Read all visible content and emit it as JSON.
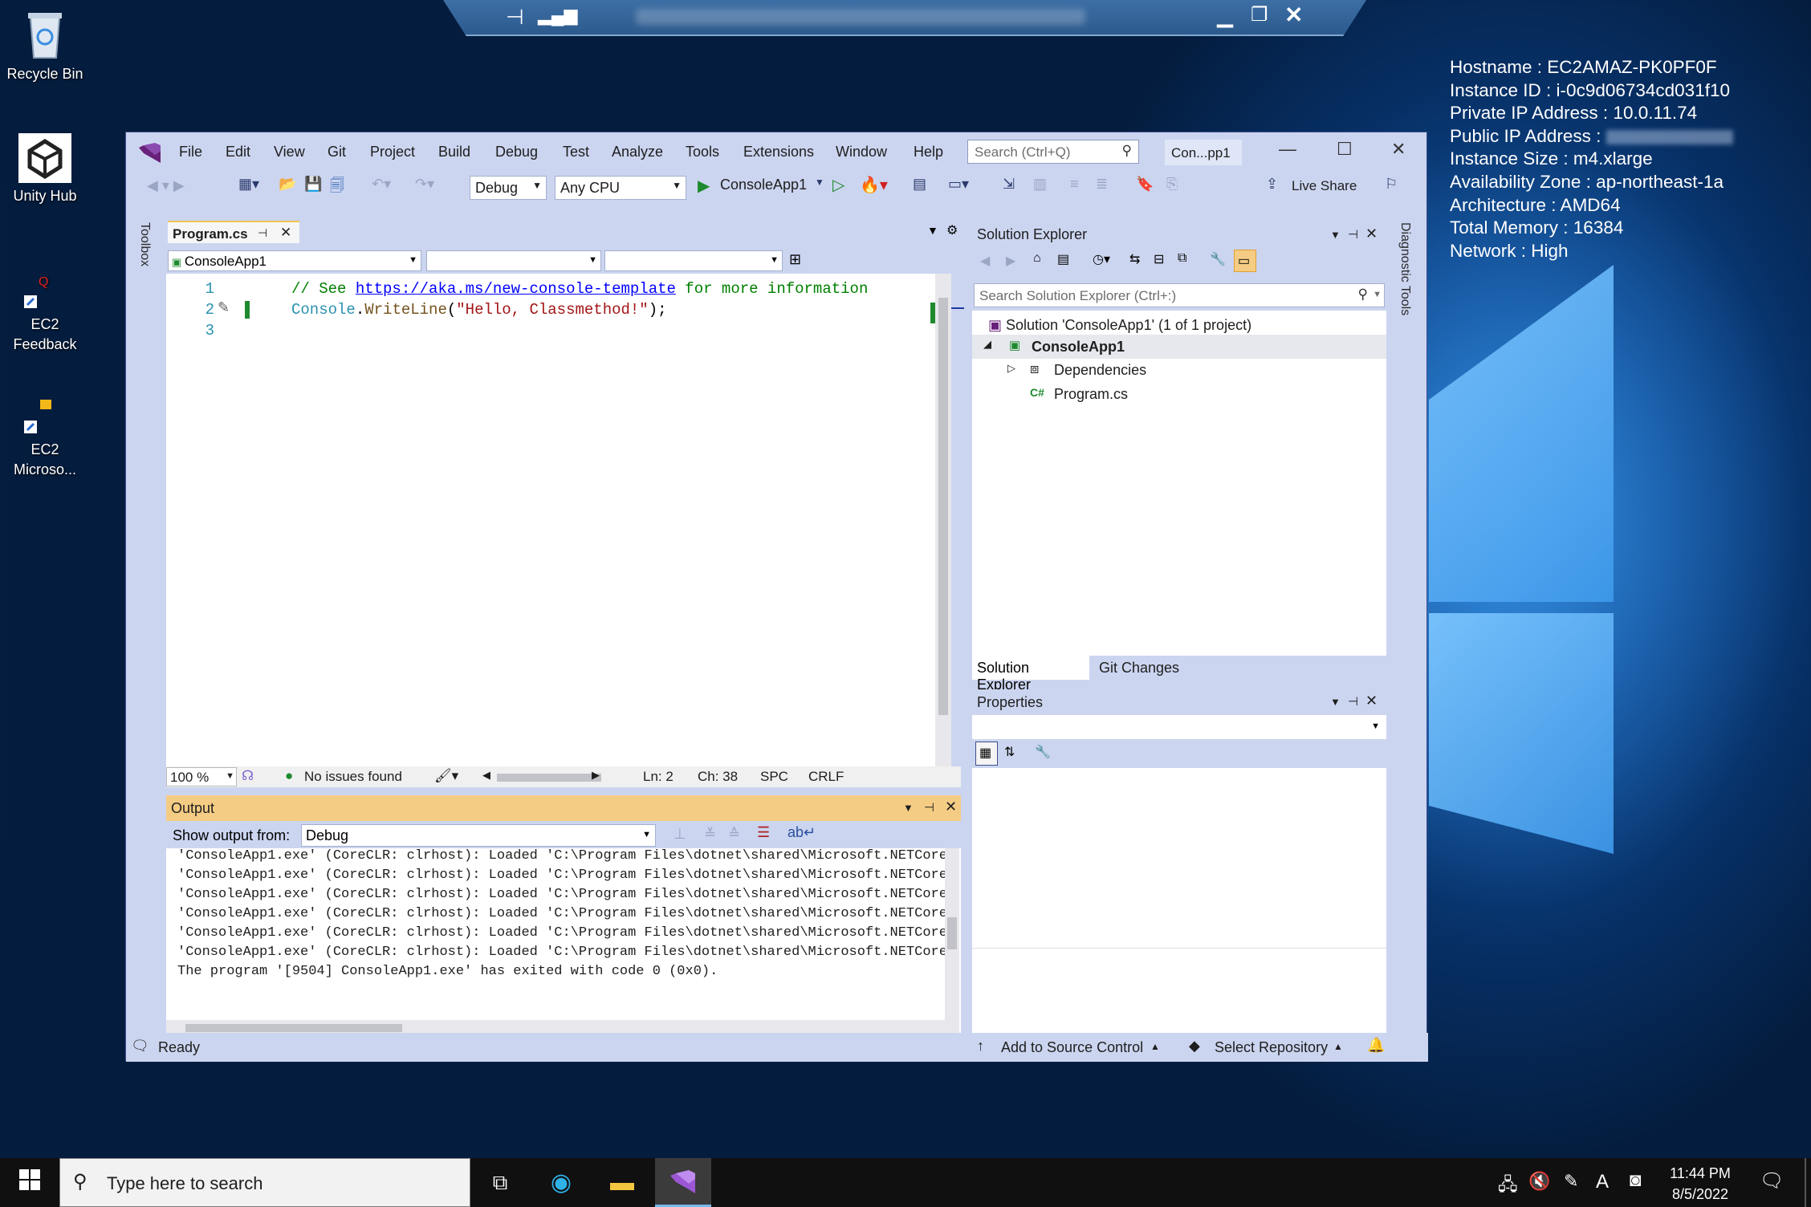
{
  "desktop": {
    "icons": [
      {
        "label": "Recycle Bin"
      },
      {
        "label": "Unity Hub"
      },
      {
        "label": "EC2 Feedback"
      },
      {
        "label": "EC2 Microso..."
      }
    ]
  },
  "info": {
    "hostname": "Hostname : EC2AMAZ-PK0PF0F",
    "instance_id": "Instance ID : i-0c9d06734cd031f10",
    "private_ip": "Private IP Address : 10.0.11.74",
    "public_ip": "Public IP Address :",
    "instance_size": "Instance Size : m4.xlarge",
    "az": "Availability Zone : ap-northeast-1a",
    "arch": "Architecture : AMD64",
    "memory": "Total Memory : 16384",
    "network": "Network : High"
  },
  "vs": {
    "menu": [
      "File",
      "Edit",
      "View",
      "Git",
      "Project",
      "Build",
      "Debug",
      "Test",
      "Analyze",
      "Tools",
      "Extensions",
      "Window",
      "Help"
    ],
    "search_placeholder": "Search (Ctrl+Q)",
    "solution_short": "Con...pp1",
    "config": "Debug",
    "platform": "Any CPU",
    "start_target": "ConsoleApp1",
    "live_share": "Live Share",
    "toolbox": "Toolbox",
    "diagnostic": "Diagnostic Tools",
    "tab": "Program.cs",
    "nav_project": "ConsoleApp1",
    "code": {
      "l1_num": "1",
      "l2_num": "2",
      "l3_num": "3",
      "l1_comment": "// See ",
      "l1_link": "https://aka.ms/new-console-template",
      "l1_tail": " for more information",
      "l2_a": "Console",
      "l2_b": ".",
      "l2_c": "WriteLine",
      "l2_d": "(",
      "l2_e": "\"Hello, Classmethod!\"",
      "l2_f": ");"
    },
    "editor_status": {
      "zoom": "100 %",
      "issues": "No issues found",
      "ln": "Ln: 2",
      "ch": "Ch: 38",
      "spc": "SPC",
      "crlf": "CRLF"
    },
    "output": {
      "title": "Output",
      "show_from": "Show output from:",
      "source": "Debug",
      "lines": [
        "'ConsoleApp1.exe' (CoreCLR: clrhost): Loaded 'C:\\Program Files\\dotnet\\shared\\Microsoft.NETCore.",
        "'ConsoleApp1.exe' (CoreCLR: clrhost): Loaded 'C:\\Program Files\\dotnet\\shared\\Microsoft.NETCore.",
        "'ConsoleApp1.exe' (CoreCLR: clrhost): Loaded 'C:\\Program Files\\dotnet\\shared\\Microsoft.NETCore.",
        "'ConsoleApp1.exe' (CoreCLR: clrhost): Loaded 'C:\\Program Files\\dotnet\\shared\\Microsoft.NETCore.",
        "'ConsoleApp1.exe' (CoreCLR: clrhost): Loaded 'C:\\Program Files\\dotnet\\shared\\Microsoft.NETCore.",
        "'ConsoleApp1.exe' (CoreCLR: clrhost): Loaded 'C:\\Program Files\\dotnet\\shared\\Microsoft.NETCore.",
        "The program '[9504] ConsoleApp1.exe' has exited with code 0 (0x0)."
      ]
    },
    "solution_explorer": {
      "title": "Solution Explorer",
      "search": "Search Solution Explorer (Ctrl+:)",
      "solution": "Solution 'ConsoleApp1' (1 of 1 project)",
      "project": "ConsoleApp1",
      "deps": "Dependencies",
      "file": "Program.cs",
      "tab1": "Solution Explorer",
      "tab2": "Git Changes"
    },
    "properties": {
      "title": "Properties"
    },
    "statusbar": {
      "ready": "Ready",
      "source_control": "Add to Source Control",
      "repo": "Select Repository"
    }
  },
  "taskbar": {
    "search": "Type here to search",
    "time": "11:44 PM",
    "date": "8/5/2022"
  },
  "colors": {
    "vs_chrome": "#ccd5f0",
    "output_header": "#f5cc84",
    "accent": "#68217a"
  }
}
